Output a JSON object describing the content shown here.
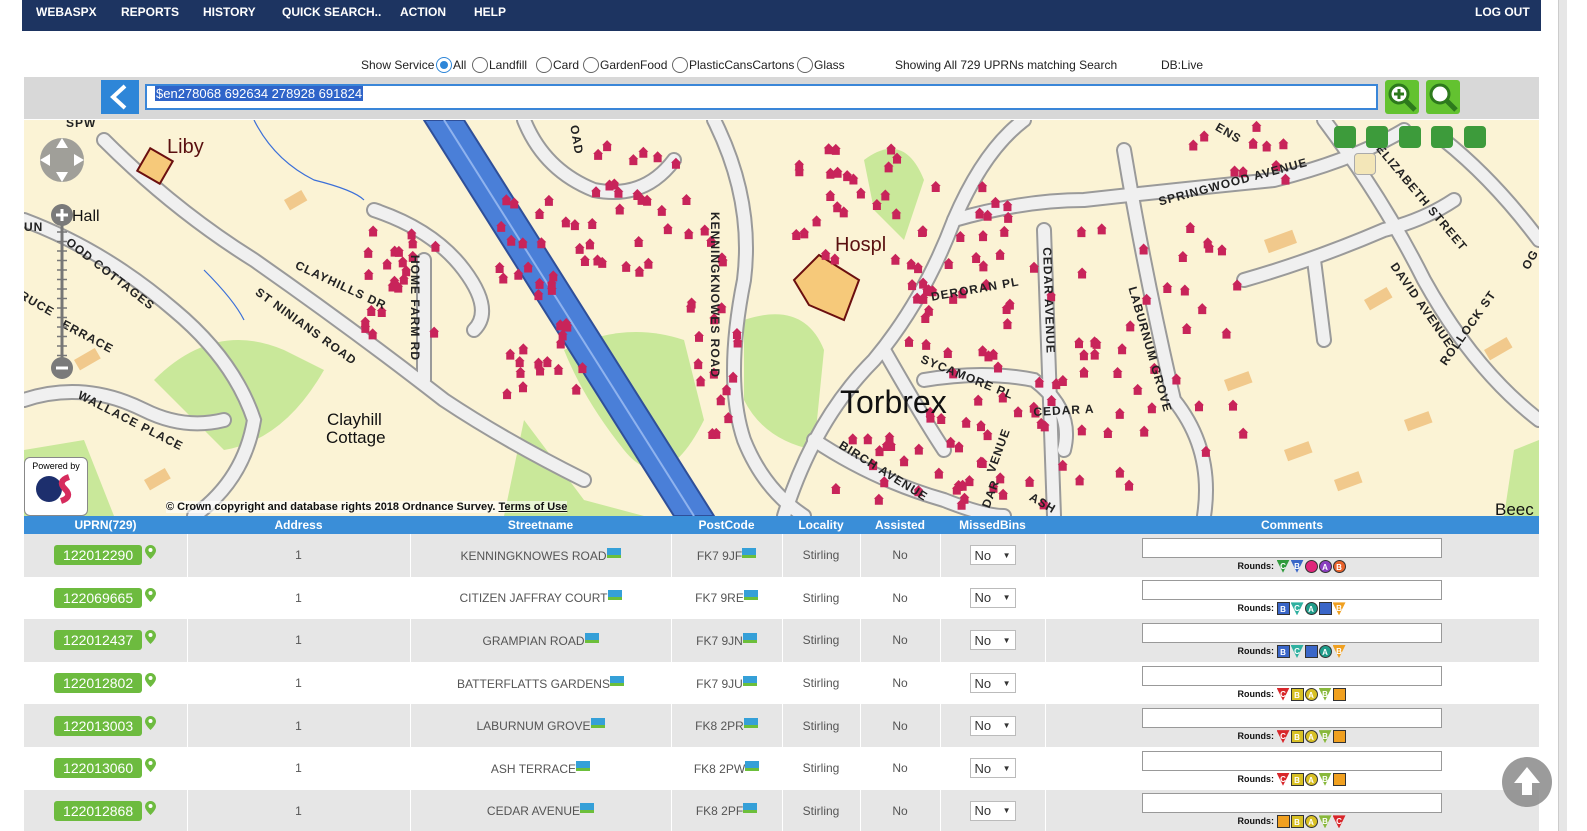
{
  "nav": {
    "items": [
      "WEBASPX",
      "REPORTS",
      "HISTORY",
      "QUICK SEARCH..",
      "ACTION",
      "HELP"
    ],
    "logout": "LOG OUT"
  },
  "service_filter": {
    "label": "Show Service",
    "options": [
      "All",
      "Landfill",
      "Card",
      "GardenFood",
      "PlasticCansCartons",
      "Glass"
    ],
    "selected": "All",
    "summary": "Showing All 729 UPRNs matching Search",
    "db": "DB:Live"
  },
  "search": {
    "value": "$en278068 692634 278928 691824"
  },
  "map": {
    "labels": {
      "liby": "Liby",
      "hall": "Hall",
      "hospl": "Hospl",
      "torbrex": "Torbrex",
      "clayhill": "Clayhill",
      "cottage": "Cottage",
      "beec": "Beec",
      "clayhills_dr": "CLAYHILLS DR",
      "st_ninians_road": "ST NINIANS ROAD",
      "home_farm_rd": "HOME FARM RD",
      "wallace_place": "WALLACE PLACE",
      "ood_cottages": "OOD COTTAGES",
      "errace": "ERRACE",
      "kenningknowes_road": "KENNINGKNOWES ROAD",
      "springwood_avenue": "SPRINGWOOD AVENUE",
      "elizabeth_street": "ELIZABETH STREET",
      "david_avenue": "DAVID AVENUE",
      "rollock_st": "ROLLOCK ST",
      "cedar_avenue": "CEDAR AVENUE",
      "laburnum_grove": "LABURNUM GROVE",
      "deroran_pl": "DERORAN PL",
      "sycamore_pl": "SYCAMORE PL",
      "cedar_a": "CEDAR A",
      "birch_avenue": "BIRCH AVENUE",
      "ash": "ASH",
      "dar": "DAR",
      "oad": "OAD",
      "ens": "ENS",
      "spw": "SPW",
      "og": "OG",
      "un": "UN",
      "ruce": "RUCE",
      "venue": "VENUE"
    },
    "powered_by": "Powered by",
    "copyright": "© Crown copyright and database rights 2018 Ordnance Survey.",
    "terms": "Terms of Use"
  },
  "table": {
    "headers": [
      "UPRN(729)",
      "Address",
      "Streetname",
      "PostCode",
      "Locality",
      "Assisted",
      "MissedBins",
      "Comments"
    ],
    "rounds_label": "Rounds:",
    "rows": [
      {
        "uprn": "122012290",
        "address": "1",
        "street": "KENNINGKNOWES ROAD",
        "postcode": "FK7 9JF",
        "locality": "Stirling",
        "assisted": "No",
        "missed": "No"
      },
      {
        "uprn": "122069665",
        "address": "1",
        "street": "CITIZEN JAFFRAY COURT",
        "postcode": "FK7 9RE",
        "locality": "Stirling",
        "assisted": "No",
        "missed": "No"
      },
      {
        "uprn": "122012437",
        "address": "1",
        "street": "GRAMPIAN ROAD",
        "postcode": "FK7 9JN",
        "locality": "Stirling",
        "assisted": "No",
        "missed": "No"
      },
      {
        "uprn": "122012802",
        "address": "1",
        "street": "BATTERFLATTS GARDENS",
        "postcode": "FK7 9JU",
        "locality": "Stirling",
        "assisted": "No",
        "missed": "No"
      },
      {
        "uprn": "122013003",
        "address": "1",
        "street": "LABURNUM GROVE",
        "postcode": "FK8 2PR",
        "locality": "Stirling",
        "assisted": "No",
        "missed": "No"
      },
      {
        "uprn": "122013060",
        "address": "1",
        "street": "ASH TERRACE",
        "postcode": "FK8 2PW",
        "locality": "Stirling",
        "assisted": "No",
        "missed": "No"
      },
      {
        "uprn": "122012868",
        "address": "1",
        "street": "CEDAR AVENUE",
        "postcode": "FK8 2PF",
        "locality": "Stirling",
        "assisted": "No",
        "missed": "No"
      }
    ]
  },
  "round_sets": [
    [
      [
        "C",
        "#2f9a3b",
        "tri"
      ],
      [
        "B",
        "#3a66c8",
        "tri"
      ],
      [
        "",
        "#e0267a",
        "circ"
      ],
      [
        "A",
        "#8a3ec0",
        "circ"
      ],
      [
        "B",
        "#e8622b",
        "circ"
      ]
    ],
    [
      [
        "B",
        "#3a66c8",
        "sq"
      ],
      [
        "C",
        "#2fb0a0",
        "tri"
      ],
      [
        "A",
        "#1f9c8a",
        "circ"
      ],
      [
        "",
        "#3a66c8",
        "sq"
      ],
      [
        "B",
        "#f0a020",
        "tri"
      ]
    ],
    [
      [
        "B",
        "#3a66c8",
        "sq"
      ],
      [
        "C",
        "#2fb0a0",
        "tri"
      ],
      [
        "",
        "#3a66c8",
        "sq"
      ],
      [
        "A",
        "#1f9c8a",
        "circ"
      ],
      [
        "B",
        "#f0a020",
        "tri"
      ]
    ],
    [
      [
        "C",
        "#d8262a",
        "tri"
      ],
      [
        "B",
        "#d8c025",
        "sq"
      ],
      [
        "A",
        "#d8c025",
        "circ"
      ],
      [
        "B",
        "#88b83c",
        "tri"
      ],
      [
        "",
        "#f0a020",
        "sq"
      ]
    ],
    [
      [
        "C",
        "#d8262a",
        "tri"
      ],
      [
        "B",
        "#d8c025",
        "sq"
      ],
      [
        "A",
        "#d8c025",
        "circ"
      ],
      [
        "B",
        "#88b83c",
        "tri"
      ],
      [
        "",
        "#f0a020",
        "sq"
      ]
    ],
    [
      [
        "C",
        "#d8262a",
        "tri"
      ],
      [
        "B",
        "#d8c025",
        "sq"
      ],
      [
        "A",
        "#d8c025",
        "circ"
      ],
      [
        "B",
        "#88b83c",
        "tri"
      ],
      [
        "",
        "#f0a020",
        "sq"
      ]
    ],
    [
      [
        "",
        "#f0a020",
        "sq"
      ],
      [
        "B",
        "#d8c025",
        "sq"
      ],
      [
        "A",
        "#d8c025",
        "circ"
      ],
      [
        "B",
        "#88b83c",
        "tri"
      ],
      [
        "C",
        "#d8262a",
        "tri"
      ]
    ]
  ],
  "icons": {
    "back": "chevron-left-icon",
    "zoom_add": "zoom-in-icon",
    "zoom_search": "magnifier-icon",
    "pin": "map-pin-icon",
    "map_flag": "show-on-map-icon",
    "scroll_top": "arrow-up-icon"
  },
  "colors": {
    "nav": "#1d3461",
    "accent": "#2e86d8",
    "uprn": "#6dbb3f",
    "house": "#c8245a",
    "road": "#b5b5b5",
    "motorway": "#4a7fd8",
    "park": "#c9e89a",
    "hospital": "#f6c97a"
  }
}
